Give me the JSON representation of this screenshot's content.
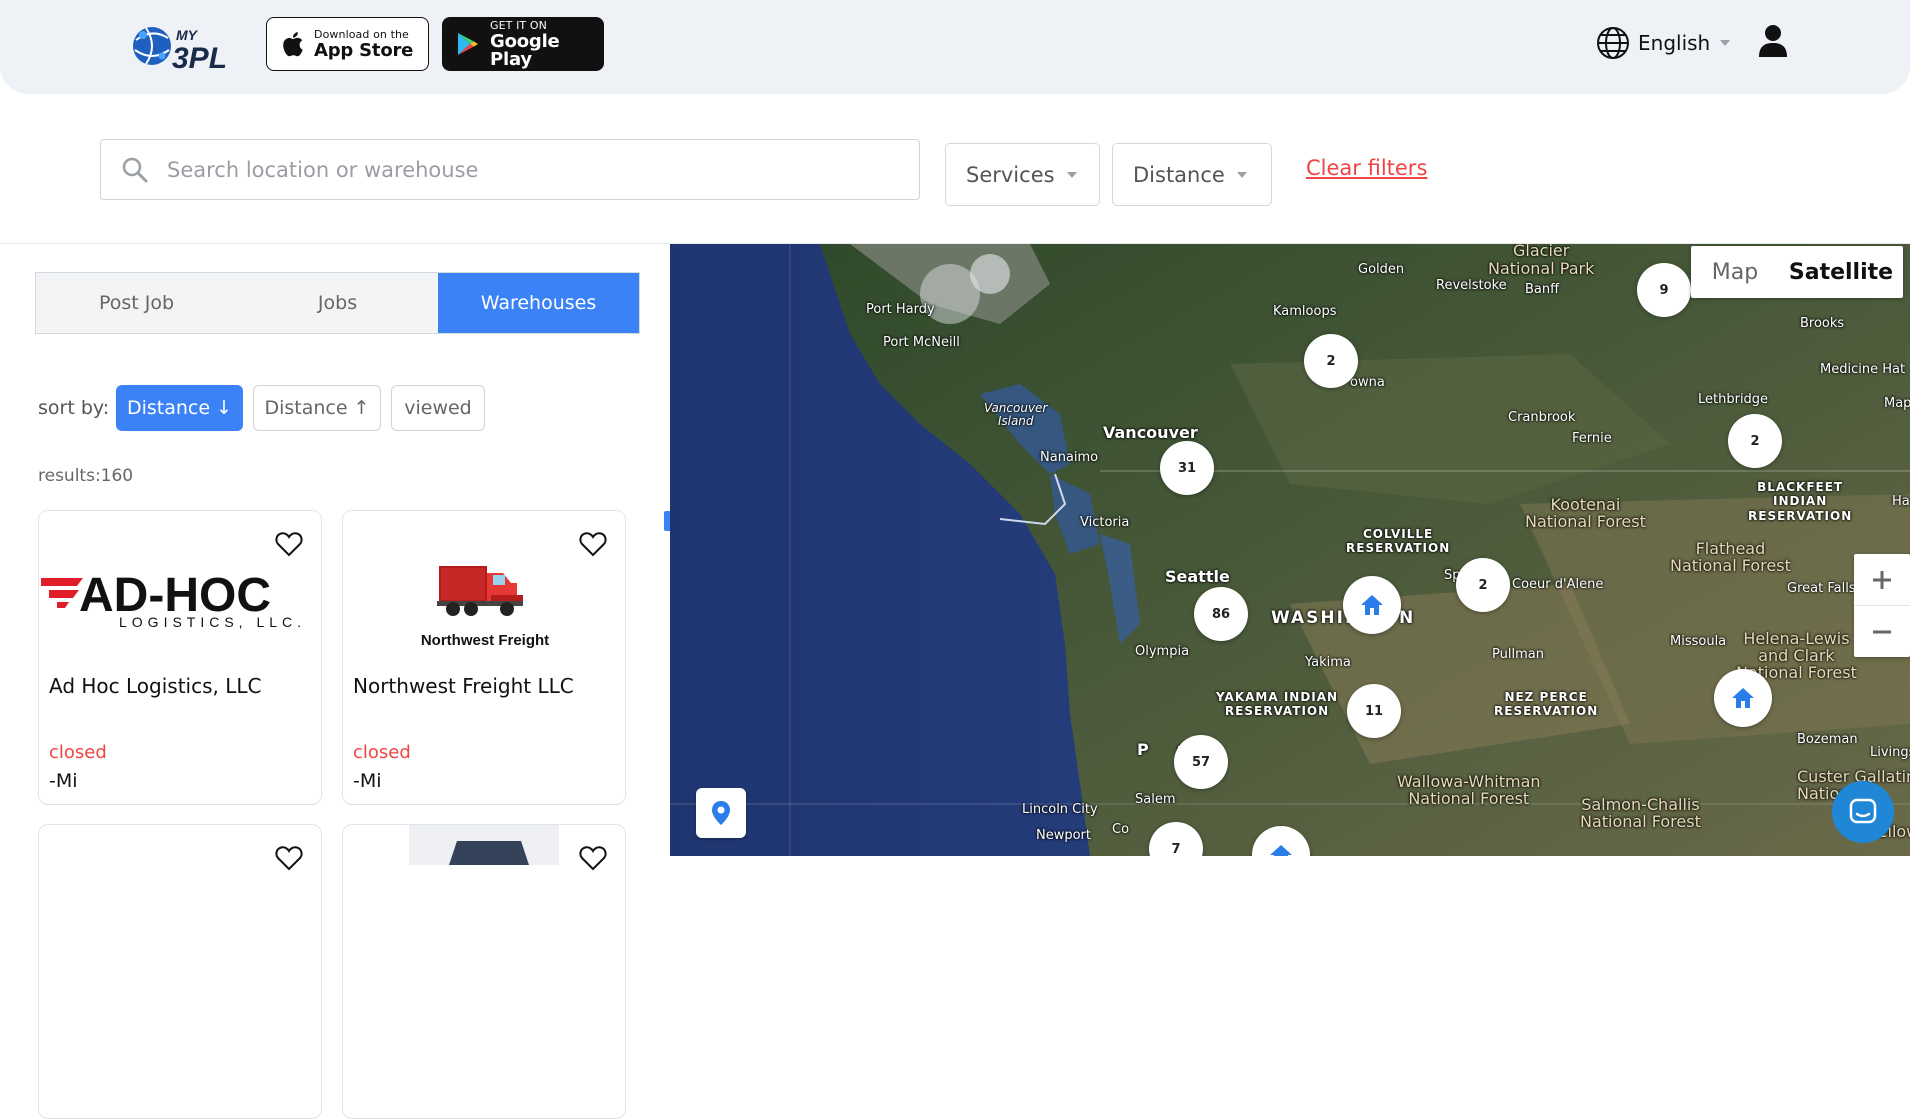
{
  "header": {
    "logo_text": "MY 3PL",
    "app_store": {
      "small": "Download on the",
      "big": "App Store"
    },
    "google_play": {
      "small": "GET IT ON",
      "big": "Google Play"
    },
    "language": "English"
  },
  "filters": {
    "search_placeholder": "Search location or warehouse",
    "services": "Services",
    "distance": "Distance",
    "clear": "Clear filters"
  },
  "tabs": [
    {
      "label": "Post Job",
      "active": false
    },
    {
      "label": "Jobs",
      "active": false
    },
    {
      "label": "Warehouses",
      "active": true
    }
  ],
  "sort": {
    "label": "sort by:",
    "options": [
      "Distance ↓",
      "Distance ↑",
      "viewed"
    ],
    "active_index": 0
  },
  "results": "results:160",
  "cards": [
    {
      "name": "Ad Hoc Logistics, LLC",
      "status": "closed",
      "distance": "-Mi",
      "logo_text_1": "AD-HOC",
      "logo_text_2": "LOGISTICS, LLC."
    },
    {
      "name": "Northwest Freight LLC",
      "status": "closed",
      "distance": "-Mi",
      "logo_text_1": "Northwest Freight"
    }
  ],
  "map": {
    "toggle": {
      "map": "Map",
      "satellite": "Satellite"
    },
    "clusters": [
      "9",
      "2",
      "2",
      "31",
      "86",
      "2",
      "11",
      "57",
      "7"
    ],
    "places": {
      "port_hardy": "Port Hardy",
      "port_mcneill": "Port McNeill",
      "vancouver_island": "Vancouver\nIsland",
      "vancouver": "Vancouver",
      "nanaimo": "Nanaimo",
      "victoria": "Victoria",
      "seattle": "Seattle",
      "olympia": "Olympia",
      "washington": "WASHIN",
      "washington_rest": "N",
      "yakima": "Yakima",
      "yakama": "YAKAMA INDIAN\nRESERVATION",
      "colville": "COLVILLE\nRESERVATION",
      "kamloops": "Kamloops",
      "kelowna": "owna",
      "revelstoke": "Revelstoke",
      "golden": "Golden",
      "glacier": "Glacier\nNational Park",
      "banff": "Banff",
      "cranbrook": "Cranbrook",
      "fernie": "Fernie",
      "lethbridge": "Lethbridge",
      "brooks": "Brooks",
      "medicine_hat": "Medicine Hat",
      "blackfeet": "BLACKFEET\nINDIAN\nRESERVATION",
      "kootenai": "Kootenai\nNational Forest",
      "flathead": "Flathead\nNational Forest",
      "great_falls": "Great Falls",
      "coeur": "Coeur d'Alene",
      "spokane": "Sp",
      "pullman": "Pullman",
      "missoula": "Missoula",
      "nez_perce": "NEZ PERCE\nRESERVATION",
      "helena": "Helena-Lewis\nand Clark\nNational Forest",
      "portland": "P     nd",
      "salem": "Salem",
      "lincoln": "Lincoln City",
      "newport": "Newport",
      "corvallis": "Co",
      "wallowa": "Wallowa-Whitman\nNational Forest",
      "salmon": "Salmon-Challis\nNational Forest",
      "bozeman": "Bozeman",
      "custer": "Custer Gallatin\nNational",
      "livingston": "Livings",
      "yellowstone": "Yellowstone",
      "map_edge": "Map",
      "ha": "Ha"
    }
  }
}
